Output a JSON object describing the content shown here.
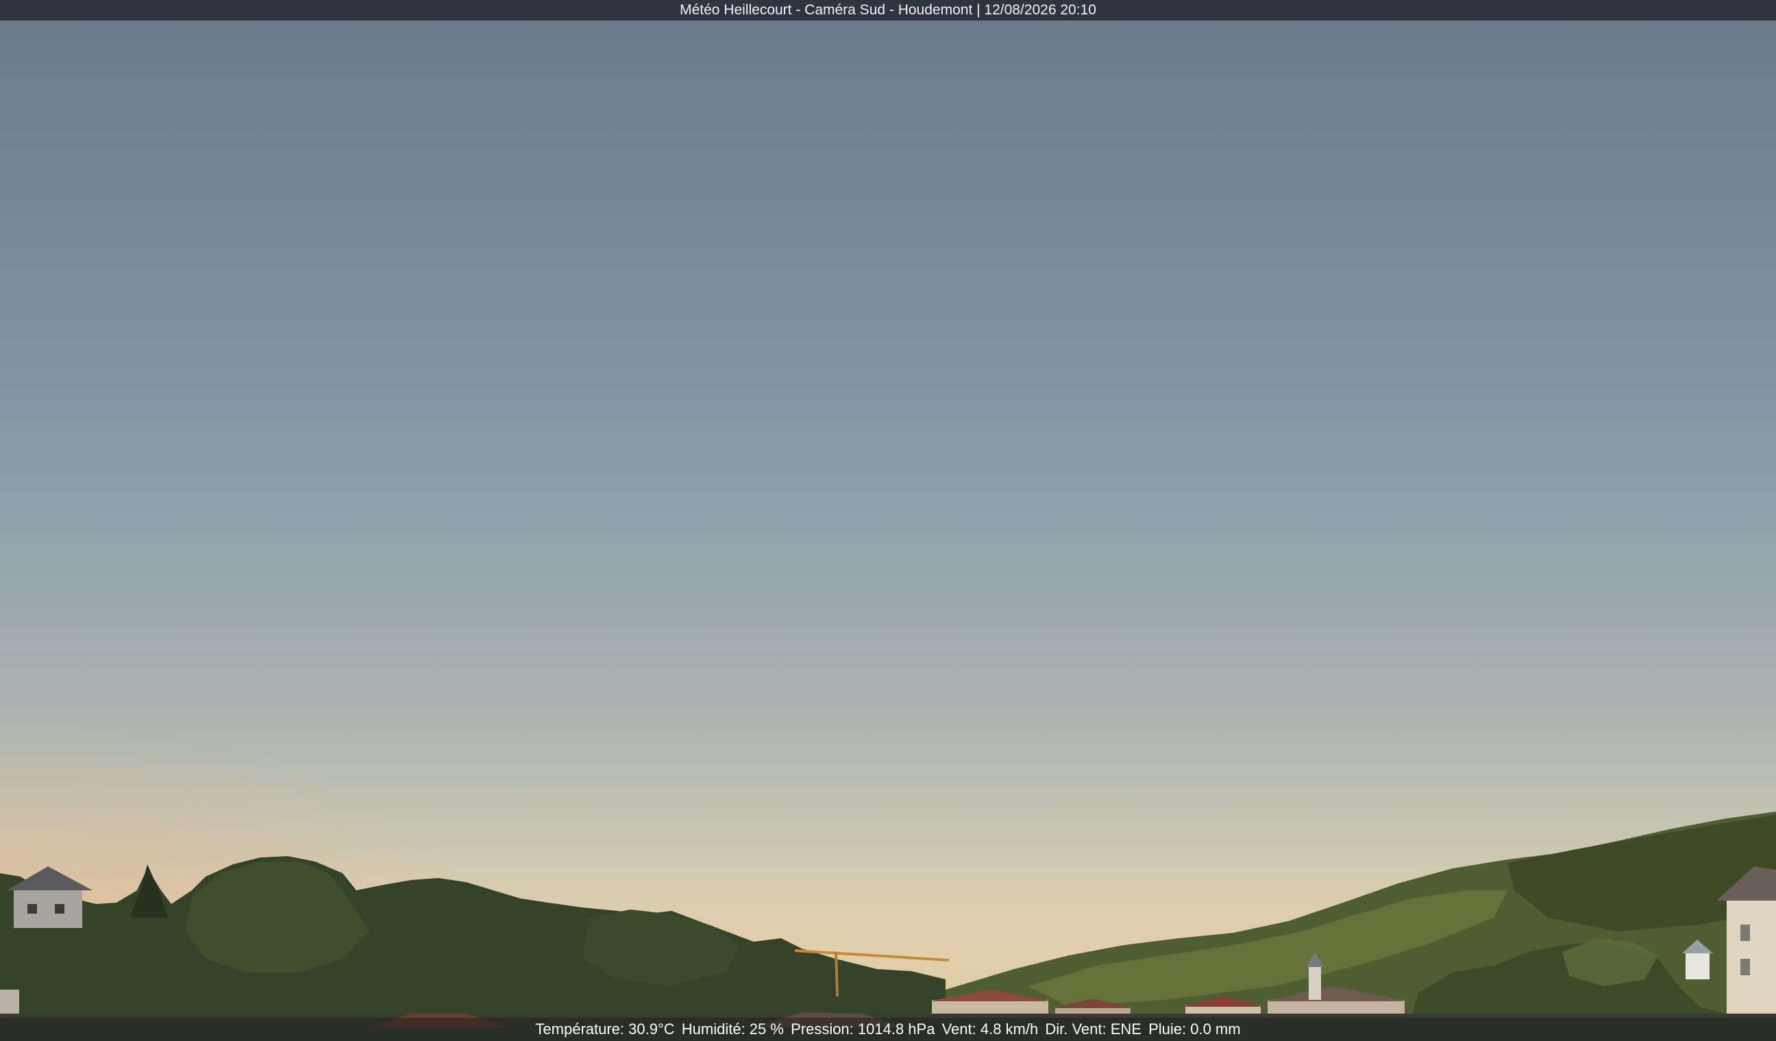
{
  "header": {
    "title": "Météo Heillecourt - Caméra Sud - Houdemont | 12/08/2026 20:10"
  },
  "weather": {
    "temperature": "Température: 30.9°C",
    "humidity": "Humidité: 25 %",
    "pressure": "Pression: 1014.8 hPa",
    "wind_speed": "Vent: 4.8 km/h",
    "wind_direction": "Dir. Vent: ENE",
    "rain": "Pluie: 0.0 mm"
  },
  "colors": {
    "sky_top": "#6a788b",
    "sky_horizon": "#e3cfac",
    "trees_dark": "#2f3b24",
    "trees_mid": "#4d5c33",
    "bar_bg": "#2f3540"
  }
}
